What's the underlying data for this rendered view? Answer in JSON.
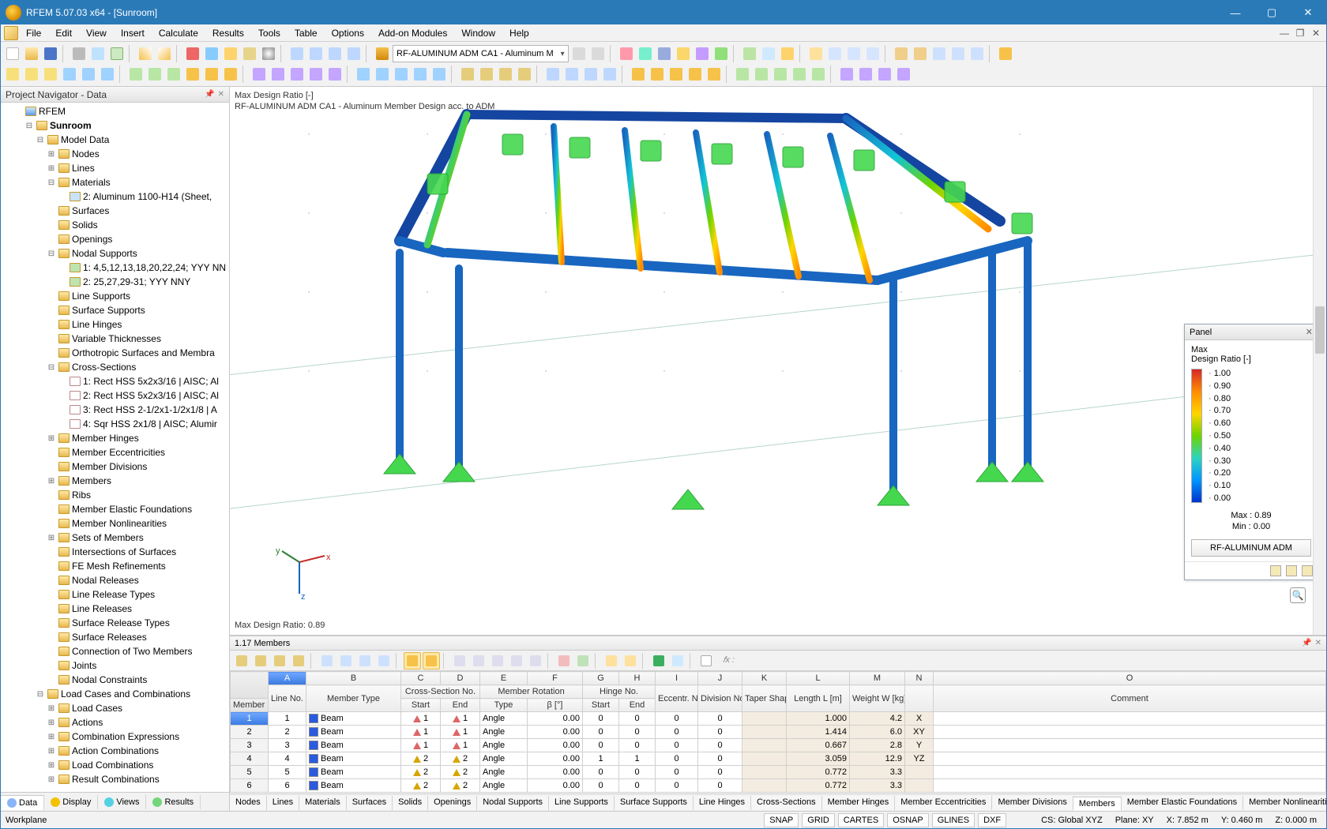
{
  "app_title": "RFEM 5.07.03 x64 - [Sunroom]",
  "menu": [
    "File",
    "Edit",
    "View",
    "Insert",
    "Calculate",
    "Results",
    "Tools",
    "Table",
    "Options",
    "Add-on Modules",
    "Window",
    "Help"
  ],
  "module_selector": "RF-ALUMINUM ADM CA1 - Aluminum M",
  "navigator": {
    "title": "Project Navigator - Data",
    "root": "RFEM",
    "project": "Sunroom",
    "model_data": "Model Data",
    "items": {
      "nodes": "Nodes",
      "lines": "Lines",
      "materials": "Materials",
      "material_1": "2: Aluminum 1100-H14 (Sheet,",
      "surfaces": "Surfaces",
      "solids": "Solids",
      "openings": "Openings",
      "nodal_supports": "Nodal Supports",
      "ns1": "1: 4,5,12,13,18,20,22,24; YYY NN",
      "ns2": "2: 25,27,29-31; YYY NNY",
      "line_supports": "Line Supports",
      "surface_supports": "Surface Supports",
      "line_hinges": "Line Hinges",
      "var_thick": "Variable Thicknesses",
      "ortho": "Orthotropic Surfaces and Membra",
      "cross_sections": "Cross-Sections",
      "cs1": "1: Rect HSS 5x2x3/16 | AISC; Al",
      "cs2": "2: Rect HSS 5x2x3/16 | AISC; Al",
      "cs3": "3: Rect HSS 2-1/2x1-1/2x1/8 | A",
      "cs4": "4: Sqr HSS 2x1/8 | AISC; Alumir",
      "member_hinges": "Member Hinges",
      "member_ecc": "Member Eccentricities",
      "member_div": "Member Divisions",
      "members": "Members",
      "ribs": "Ribs",
      "mef": "Member Elastic Foundations",
      "mnl": "Member Nonlinearities",
      "sets": "Sets of Members",
      "intersections": "Intersections of Surfaces",
      "fe_mesh": "FE Mesh Refinements",
      "nodal_rel": "Nodal Releases",
      "lrt": "Line Release Types",
      "lr": "Line Releases",
      "srt": "Surface Release Types",
      "sr": "Surface Releases",
      "conn2": "Connection of Two Members",
      "joints": "Joints",
      "nodal_con": "Nodal Constraints"
    },
    "lcc": "Load Cases and Combinations",
    "lcc_items": {
      "load_cases": "Load Cases",
      "actions": "Actions",
      "combo_exp": "Combination Expressions",
      "action_combo": "Action Combinations",
      "load_combo": "Load Combinations",
      "result_combo": "Result Combinations"
    },
    "tabs": [
      "Data",
      "Display",
      "Views",
      "Results"
    ]
  },
  "viewport": {
    "line1": "Max Design Ratio [-]",
    "line2": "RF-ALUMINUM ADM CA1 - Aluminum Member Design acc. to ADM",
    "max_ratio_label": "Max Design Ratio: 0.89",
    "axes": {
      "x": "x",
      "y": "y",
      "z": "z"
    }
  },
  "legend": {
    "title": "Panel",
    "h1": "Max",
    "h2": "Design Ratio [-]",
    "ticks": [
      "1.00",
      "0.90",
      "0.80",
      "0.70",
      "0.60",
      "0.50",
      "0.40",
      "0.30",
      "0.20",
      "0.10",
      "0.00"
    ],
    "max": "Max : 0.89",
    "min": "Min : 0.00",
    "button": "RF-ALUMINUM ADM"
  },
  "grid": {
    "title": "1.17 Members",
    "formula": "𝑓x :",
    "letters": [
      "A",
      "B",
      "C",
      "D",
      "E",
      "F",
      "G",
      "H",
      "I",
      "J",
      "K",
      "L",
      "M",
      "N",
      "O"
    ],
    "head1": {
      "memberno": "Member\nNo.",
      "lineno": "Line\nNo.",
      "mtype": "Member Type",
      "csno": "Cross-Section No.",
      "mrot": "Member Rotation",
      "hinge": "Hinge No.",
      "ecc": "Eccentr.\nNo.",
      "div": "Division\nNo.",
      "taper": "Taper\nShape",
      "len": "Length\nL [m]",
      "wt": "Weight\nW [kg]",
      "comment": "Comment"
    },
    "head2": {
      "start": "Start",
      "end": "End",
      "type": "Type",
      "beta": "β [°]",
      "startH": "Start",
      "endH": "End"
    },
    "rows": [
      {
        "n": 1,
        "line": 1,
        "mt": "Beam",
        "csS": 1,
        "csE": 1,
        "rt": "Angle",
        "b": "0.00",
        "hs": 0,
        "he": 0,
        "ec": 0,
        "dv": 0,
        "len": "1.000",
        "wt": "4.2",
        "ax": "X"
      },
      {
        "n": 2,
        "line": 2,
        "mt": "Beam",
        "csS": 1,
        "csE": 1,
        "rt": "Angle",
        "b": "0.00",
        "hs": 0,
        "he": 0,
        "ec": 0,
        "dv": 0,
        "len": "1.414",
        "wt": "6.0",
        "ax": "XY"
      },
      {
        "n": 3,
        "line": 3,
        "mt": "Beam",
        "csS": 1,
        "csE": 1,
        "rt": "Angle",
        "b": "0.00",
        "hs": 0,
        "he": 0,
        "ec": 0,
        "dv": 0,
        "len": "0.667",
        "wt": "2.8",
        "ax": "Y"
      },
      {
        "n": 4,
        "line": 4,
        "mt": "Beam",
        "csS": 2,
        "csE": 2,
        "rt": "Angle",
        "b": "0.00",
        "hs": 1,
        "he": 1,
        "ec": 0,
        "dv": 0,
        "len": "3.059",
        "wt": "12.9",
        "ax": "YZ"
      },
      {
        "n": 5,
        "line": 5,
        "mt": "Beam",
        "csS": 2,
        "csE": 2,
        "rt": "Angle",
        "b": "0.00",
        "hs": 0,
        "he": 0,
        "ec": 0,
        "dv": 0,
        "len": "0.772",
        "wt": "3.3",
        "ax": ""
      },
      {
        "n": 6,
        "line": 6,
        "mt": "Beam",
        "csS": 2,
        "csE": 2,
        "rt": "Angle",
        "b": "0.00",
        "hs": 0,
        "he": 0,
        "ec": 0,
        "dv": 0,
        "len": "0.772",
        "wt": "3.3",
        "ax": ""
      }
    ]
  },
  "obj_tabs": [
    "Nodes",
    "Lines",
    "Materials",
    "Surfaces",
    "Solids",
    "Openings",
    "Nodal Supports",
    "Line Supports",
    "Surface Supports",
    "Line Hinges",
    "Cross-Sections",
    "Member Hinges",
    "Member Eccentricities",
    "Member Divisions",
    "Members",
    "Member Elastic Foundations",
    "Member Nonlinearities"
  ],
  "obj_tabs_active": "Members",
  "status": {
    "left": "Workplane",
    "snap": "SNAP",
    "grid": "GRID",
    "cartes": "CARTES",
    "osnap": "OSNAP",
    "glines": "GLINES",
    "dxf": "DXF",
    "cs": "CS: Global XYZ",
    "plane": "Plane: XY",
    "x": "X: 7.852 m",
    "y": "Y: 0.460 m",
    "z": "Z: 0.000 m"
  },
  "chart_data": {
    "type": "table",
    "source": "Color legend 'Design Ratio [-]' scale",
    "categories": [
      "1.00",
      "0.90",
      "0.80",
      "0.70",
      "0.60",
      "0.50",
      "0.40",
      "0.30",
      "0.20",
      "0.10",
      "0.00"
    ],
    "values": [
      1.0,
      0.9,
      0.8,
      0.7,
      0.6,
      0.5,
      0.4,
      0.3,
      0.2,
      0.1,
      0.0
    ],
    "max": 0.89,
    "min": 0.0
  }
}
